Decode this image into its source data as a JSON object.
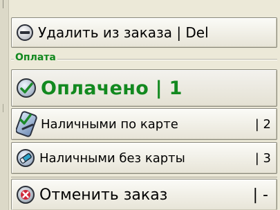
{
  "actions": {
    "delete": {
      "label": "Удалить из заказа | Del",
      "icon": "minus-circle-icon"
    },
    "payment_group": {
      "title": "Оплата",
      "paid": {
        "label": "Оплачено | 1",
        "icon": "check-pencil-icon"
      },
      "cash_card": {
        "label": "Наличными по карте",
        "hotkey": "| 2",
        "icon": "card-check-icon"
      },
      "cash_nocard": {
        "label": "Наличными без карты",
        "hotkey": "| 3",
        "icon": "pencil-eraser-icon"
      }
    },
    "cancel": {
      "label": "Отменить заказ",
      "hotkey": "| -",
      "icon": "red-x-circle-icon"
    }
  },
  "colors": {
    "accent_green": "#12891f",
    "background": "#ece9d8",
    "cancel_red": "#d0283a"
  }
}
